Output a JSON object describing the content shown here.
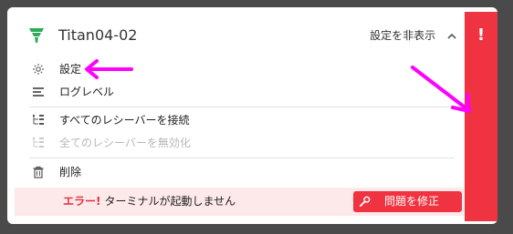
{
  "device": {
    "name": "Titan04-02"
  },
  "header": {
    "hide_settings_label": "設定を非表示"
  },
  "menu": {
    "settings": "設定",
    "log_level": "ログレベル",
    "connect_all_receivers": "すべてのレシーバーを接続",
    "disable_all_receivers": "全てのレシーバーを無効化",
    "delete": "削除"
  },
  "error": {
    "label": "エラー!",
    "message": "ターミナルが起動しません",
    "fix_button": "問題を修正"
  },
  "status": {
    "indicator": "!"
  },
  "colors": {
    "accent_red": "#ef3340",
    "error_bg": "#fde8ea",
    "logo_green": "#2eaa5c",
    "annotation_arrow": "#ff00ff"
  }
}
